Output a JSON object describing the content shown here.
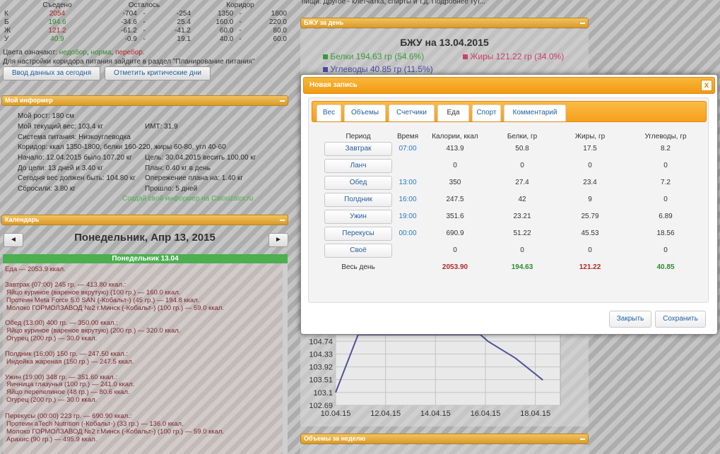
{
  "top_table": {
    "headers": [
      "Съедено",
      "Осталось",
      "Коридор"
    ],
    "rows": [
      {
        "label": "К",
        "eaten": "2054",
        "eaten_color": "red",
        "rem_a": "-704",
        "sep1": "-",
        "rem_b": "-254",
        "cor_a": "1350",
        "sep2": "-",
        "cor_b": "1800"
      },
      {
        "label": "Б",
        "eaten": "194.6",
        "eaten_color": "green",
        "rem_a": "-34.6",
        "sep1": "-",
        "rem_b": "25.4",
        "cor_a": "160.0",
        "sep2": "-",
        "cor_b": "220.0"
      },
      {
        "label": "Ж",
        "eaten": "121.2",
        "eaten_color": "red",
        "rem_a": "-61.2",
        "sep1": "-",
        "rem_b": "-41.2",
        "cor_a": "60.0",
        "sep2": "-",
        "cor_b": "80.0"
      },
      {
        "label": "У",
        "eaten": "40.9",
        "eaten_color": "green",
        "rem_a": "-0.9",
        "sep1": "-",
        "rem_b": "19.1",
        "cor_a": "40.0",
        "sep2": "-",
        "cor_b": "60.0"
      }
    ],
    "legend_prefix": "Цвета означают:",
    "legend_under": "недобор",
    "legend_norm": "норма",
    "legend_over": "перебор.",
    "settings_note": "Для настройки коридора питания зайдите в раздел \"Планирование питания\"",
    "btn_input": "Ввод данных за сегодня",
    "btn_critical": "Отметить критические дни"
  },
  "top_right_snippet": "пищи. Другое - клетчатка, спирты и т.д. Подробнее тут...",
  "informer": {
    "title": "Мой информер",
    "height": "Мой рост: 180 см",
    "weight": "Мой текущий вес: 103.4 кг",
    "bmi": "ИМТ: 31.9",
    "system": "Система питания: Низкоуглеводка",
    "corridor": "Коридор: ккал 1350-1800, белки 160-220, жиры 60-80, угл 40-60",
    "start": "Начало: 12.04.2015 было 107.20 кг",
    "goal": "Цель: 30.04.2015 весить 100.00 кг",
    "to_goal": "До цели: 13 дней и 3.40 кг",
    "plan": "План: 0.40 кг в день",
    "should_be": "Сегодня вес должен быть: 104.80 кг",
    "ahead": "Опережение плана на: 1.40 кг",
    "lost": "Сбросили: 3.80 кг",
    "passed": "Прошло: 5 дней",
    "create_link": "Создай свой информер на Calorizator.ru"
  },
  "calendar": {
    "title": "Календарь",
    "date": "Понедельник, Апр 13, 2015",
    "prev": "◄",
    "next": "►",
    "day_bar": "Понедельник 13.04",
    "lines": [
      "Еда — 2053.9 ккал.",
      "",
      "Завтрак (07:00) 245 гр. — 413.80 ккал.:",
      " Яйцо куриное (вареное вкрутую) (100 гр.) — 160.0 ккал.",
      " Протеин Meta Force 5.0 SAN (-Кобальт-) (45 гр.) — 194.8 ккал.",
      " Молоко ГОРМОЛЗАВОД №2 г.Минск (-Кобальт-) (100 гр.) — 59.0 ккал.",
      "",
      "Обед (13:00) 400 гр. — 350.00 ккал.:",
      " Яйцо куриное (вареное вкрутую) (200 гр.) — 320.0 ккал.",
      " Огурец (200 гр.) — 30.0 ккал.",
      "",
      "Полдник (16:00) 150 гр. — 247.50 ккал.:",
      " Индейка жареная (150 гр.) — 247.5 ккал.",
      "",
      "Ужин (19:00) 348 гр. — 351.60 ккал.:",
      " Яичница глазунья (100 гр.) — 241.0 ккал.",
      " Яйцо перепелиное (48 гр.) — 80.6 ккал.",
      " Огурец (200 гр.) — 30.0 ккал.",
      "",
      "Перекусы (00:00) 223 гр. — 690.90 ккал.:",
      " Протеин aTech Nutrition (-Кобальт-) (33 гр.) — 136.0 ккал.",
      " Молоко ГОРМОЛЗАВОД №2 г.Минск (-Кобальт-) (100 гр.) — 59.0 ккал.",
      " Арахис (90 гр.) — 495.9 ккал."
    ]
  },
  "bju": {
    "panel_title": "БЖУ за день",
    "heading": "БЖУ на 13.04.2015",
    "protein": "Белки 194.63 гр (54.6%)",
    "fat": "Жиры 121.22 гр (34.0%)",
    "carbs": "Углеводы 40.85 гр (11.5%)",
    "color_protein": "#3a9a3a",
    "color_fat": "#c9426a",
    "color_carbs": "#4a4aa8"
  },
  "weekly_panel_title": "Объемы за неделю",
  "chart_data": {
    "type": "line",
    "x": [
      "10.04.15",
      "12.04.15",
      "14.04.15",
      "16.04.15",
      "18.04.15"
    ],
    "y_ticks": [
      "104.74",
      "104.33",
      "103.92",
      "103.51",
      "103.1",
      "102.69"
    ],
    "series": [
      {
        "points": [
          [
            0,
            103.1
          ],
          [
            0.9,
            104.95
          ],
          [
            5.8,
            104.95
          ],
          [
            6.1,
            104.74
          ],
          [
            7.2,
            104.2
          ],
          [
            8.3,
            103.5
          ]
        ]
      }
    ],
    "ylim": [
      102.69,
      104.95
    ],
    "xlim": [
      0,
      9
    ],
    "grid": true,
    "line_color": "#55509a"
  },
  "modal": {
    "title": "Новая запись",
    "close": "x",
    "tabs": [
      "Вес",
      "Объемы",
      "Счетчики",
      "Еда",
      "Спорт",
      "Комментарий"
    ],
    "active_tab": "Еда",
    "columns": [
      "Период",
      "Время",
      "Калории, ккал",
      "Белки, гр",
      "Жиры, гр",
      "Углеводы, гр"
    ],
    "rows": [
      {
        "period": "Завтрак",
        "time": "07:00",
        "kcal": "413.9",
        "protein": "50.8",
        "fat": "17.5",
        "carbs": "8.2"
      },
      {
        "period": "Ланч",
        "time": "",
        "kcal": "0",
        "protein": "0",
        "fat": "0",
        "carbs": "0"
      },
      {
        "period": "Обед",
        "time": "13:00",
        "kcal": "350",
        "protein": "27.4",
        "fat": "23.4",
        "carbs": "7.2"
      },
      {
        "period": "Полдник",
        "time": "16:00",
        "kcal": "247.5",
        "protein": "42",
        "fat": "9",
        "carbs": "0"
      },
      {
        "period": "Ужин",
        "time": "19:00",
        "kcal": "351.6",
        "protein": "23.21",
        "fat": "25.79",
        "carbs": "6.89"
      },
      {
        "period": "Перекусы",
        "time": "00:00",
        "kcal": "690.9",
        "protein": "51.22",
        "fat": "45.53",
        "carbs": "18.56"
      },
      {
        "period": "Своё",
        "time": "",
        "kcal": "0",
        "protein": "0",
        "fat": "0",
        "carbs": "0"
      }
    ],
    "total": {
      "label": "Весь день",
      "kcal": "2053.90",
      "protein": "194.63",
      "fat": "121.22",
      "carbs": "40.85"
    },
    "btn_close": "Закрыть",
    "btn_save": "Сохранить"
  }
}
